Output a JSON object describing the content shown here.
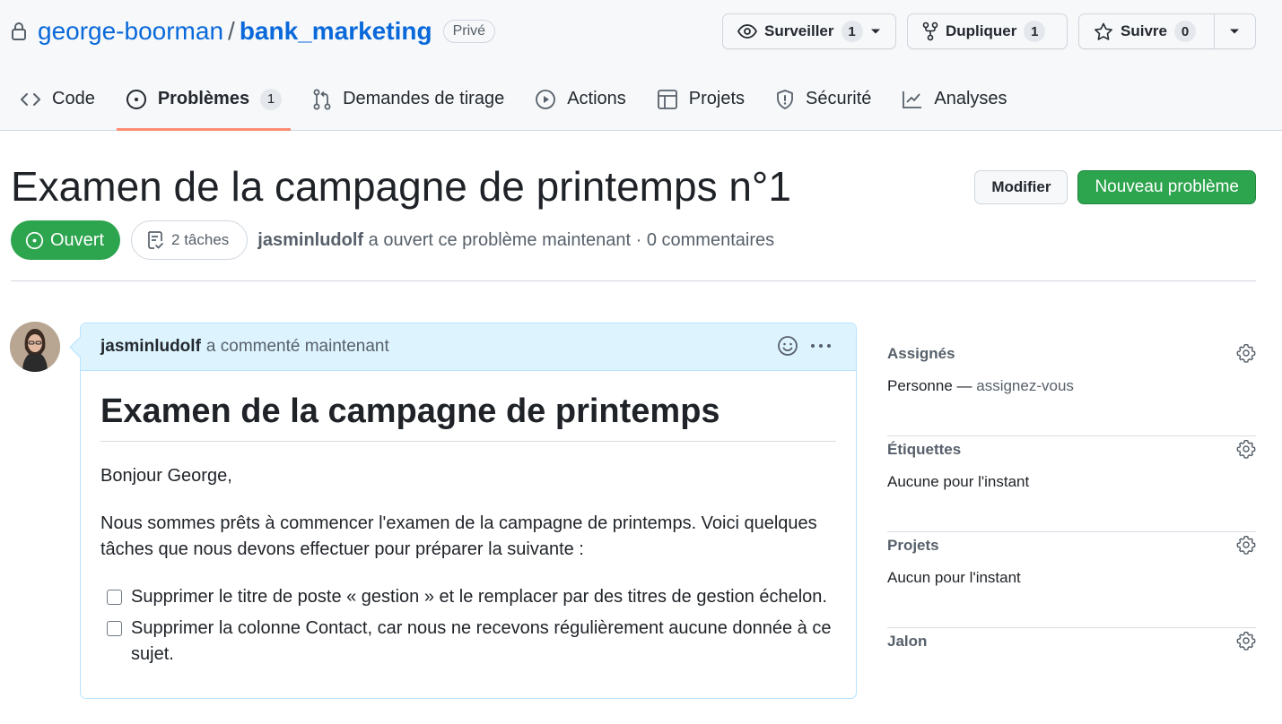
{
  "repo": {
    "owner": "george-boorman",
    "separator": "/",
    "name": "bank_marketing",
    "visibility": "Privé"
  },
  "repo_actions": {
    "watch": {
      "label": "Surveiller",
      "count": "1"
    },
    "fork": {
      "label": "Dupliquer",
      "count": "1"
    },
    "star": {
      "label": "Suivre",
      "count": "0"
    }
  },
  "nav": {
    "tabs": [
      {
        "label": "Code",
        "icon": "code-icon"
      },
      {
        "label": "Problèmes",
        "icon": "issue-opened-icon",
        "count": "1",
        "selected": true
      },
      {
        "label": "Demandes de tirage",
        "icon": "git-pull-request-icon"
      },
      {
        "label": "Actions",
        "icon": "play-icon"
      },
      {
        "label": "Projets",
        "icon": "table-icon"
      },
      {
        "label": "Sécurité",
        "icon": "shield-icon"
      },
      {
        "label": "Analyses",
        "icon": "graph-icon"
      }
    ]
  },
  "issue": {
    "title": "Examen de la campagne de printemps n°1",
    "edit_label": "Modifier",
    "new_issue_label": "Nouveau problème",
    "state": "Ouvert",
    "tasks": "2 tâches",
    "author": "jasminludolf",
    "meta": "a ouvert ce problème maintenant · 0 commentaires"
  },
  "comment": {
    "author": "jasminludolf",
    "meta": "a commenté maintenant",
    "heading": "Examen de la campagne de printemps",
    "greeting": "Bonjour George,",
    "intro": "Nous sommes prêts à commencer l'examen de la campagne de printemps. Voici quelques tâches que nous devons effectuer pour préparer la suivante :",
    "tasks": [
      "Supprimer le titre de poste « gestion » et le remplacer par des titres de gestion échelon.",
      "Supprimer la colonne Contact, car nous ne recevons régulièrement aucune donnée à ce sujet."
    ]
  },
  "sidebar": {
    "assignees": {
      "title": "Assignés",
      "value": "Personne —",
      "action": "assignez-vous"
    },
    "labels": {
      "title": "Étiquettes",
      "value": "Aucune pour l'instant"
    },
    "projects": {
      "title": "Projets",
      "value": "Aucun pour l'instant"
    },
    "milestone": {
      "title": "Jalon"
    }
  },
  "colors": {
    "accent_link": "#0969da",
    "success": "#2da44e",
    "comment_header_bg": "#ddf4ff",
    "selected_tab_underline": "#fd8c73"
  }
}
